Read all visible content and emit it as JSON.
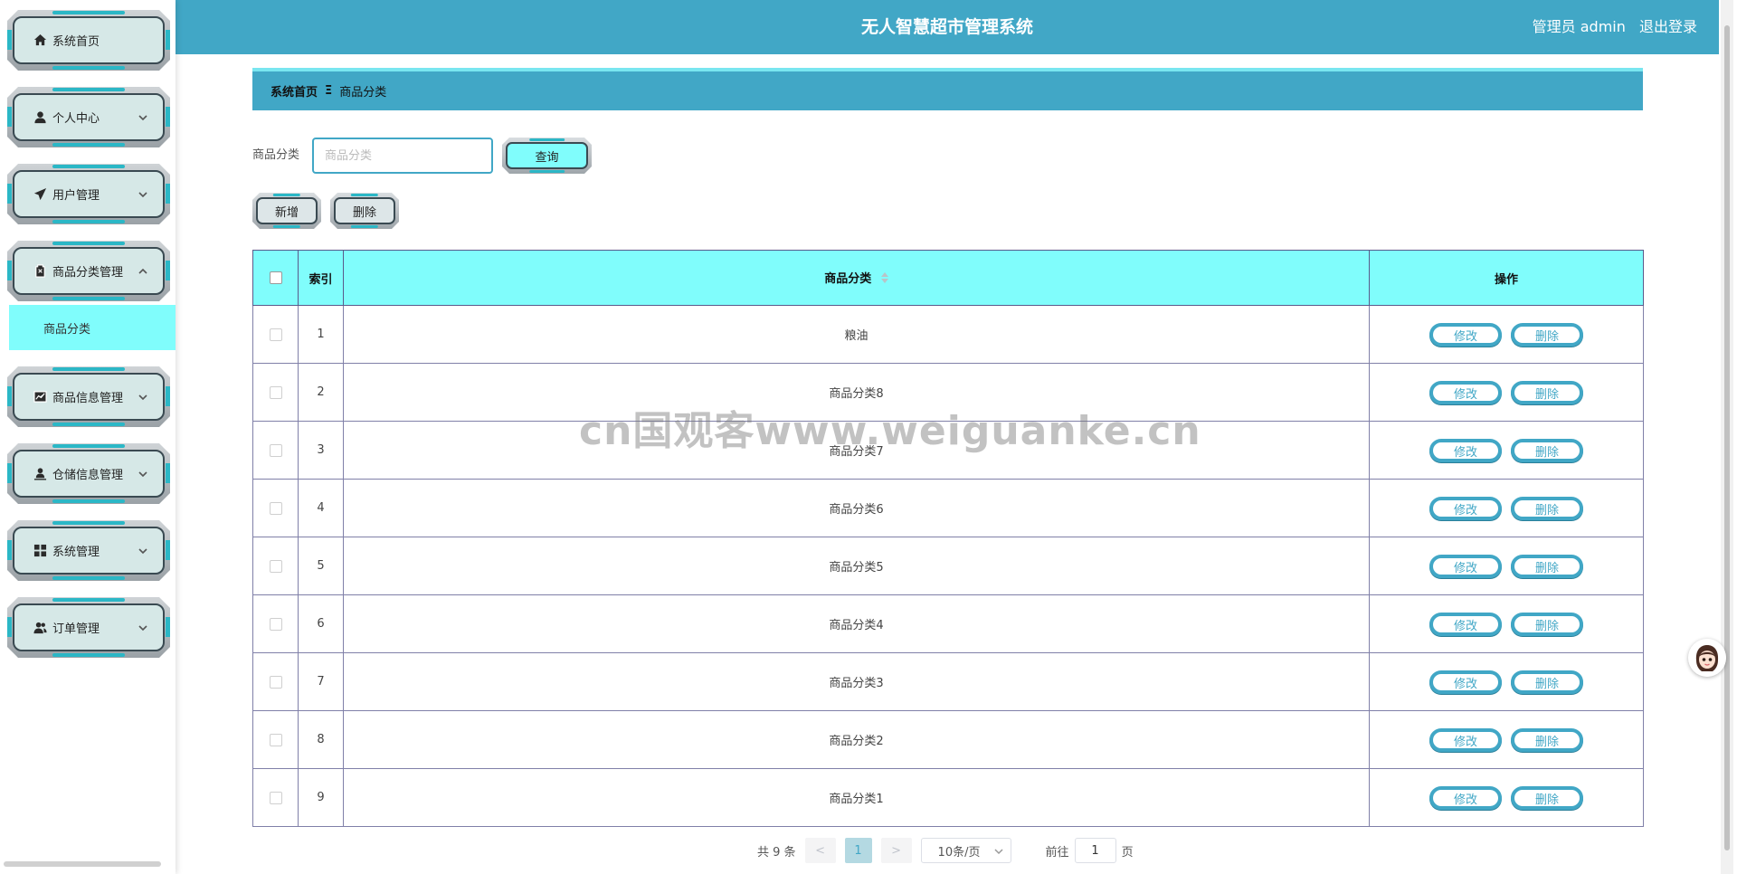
{
  "header": {
    "title": "无人智慧超市管理系统",
    "user": "管理员 admin",
    "logout": "退出登录"
  },
  "sidebar": {
    "items": [
      {
        "label": "系统首页",
        "icon": "home-icon"
      },
      {
        "label": "个人中心",
        "icon": "user-icon"
      },
      {
        "label": "用户管理",
        "icon": "paper-plane-icon"
      },
      {
        "label": "商品分类管理",
        "icon": "clipboard-icon"
      },
      {
        "label": "商品信息管理",
        "icon": "chart-icon"
      },
      {
        "label": "仓储信息管理",
        "icon": "person-stand-icon"
      },
      {
        "label": "系统管理",
        "icon": "grid-icon"
      },
      {
        "label": "订单管理",
        "icon": "users-icon"
      }
    ],
    "submenu": {
      "label": "商品分类"
    }
  },
  "breadcrumb": {
    "home": "系统首页",
    "separator": "Ξ",
    "current": "商品分类"
  },
  "search": {
    "label": "商品分类",
    "placeholder": "商品分类",
    "button": "查询"
  },
  "actions": {
    "add": "新增",
    "delete": "删除"
  },
  "table": {
    "headers": {
      "index": "索引",
      "category": "商品分类",
      "ops": "操作"
    },
    "rows": [
      {
        "index": "1",
        "category": "粮油"
      },
      {
        "index": "2",
        "category": "商品分类8"
      },
      {
        "index": "3",
        "category": "商品分类7"
      },
      {
        "index": "4",
        "category": "商品分类6"
      },
      {
        "index": "5",
        "category": "商品分类5"
      },
      {
        "index": "6",
        "category": "商品分类4"
      },
      {
        "index": "7",
        "category": "商品分类3"
      },
      {
        "index": "8",
        "category": "商品分类2"
      },
      {
        "index": "9",
        "category": "商品分类1"
      }
    ],
    "edit_label": "修改",
    "delete_label": "删除"
  },
  "pagination": {
    "total": "共 9 条",
    "prev": "<",
    "page": "1",
    "next": ">",
    "page_size": "10条/页",
    "goto_prefix": "前往",
    "goto_value": "1",
    "goto_suffix": "页"
  },
  "watermark": "cn国观客www.weiguanke.cn",
  "colors": {
    "primary": "#41a7c6",
    "cyan": "#80fdfc",
    "menu_bg": "#d6e8e7"
  }
}
